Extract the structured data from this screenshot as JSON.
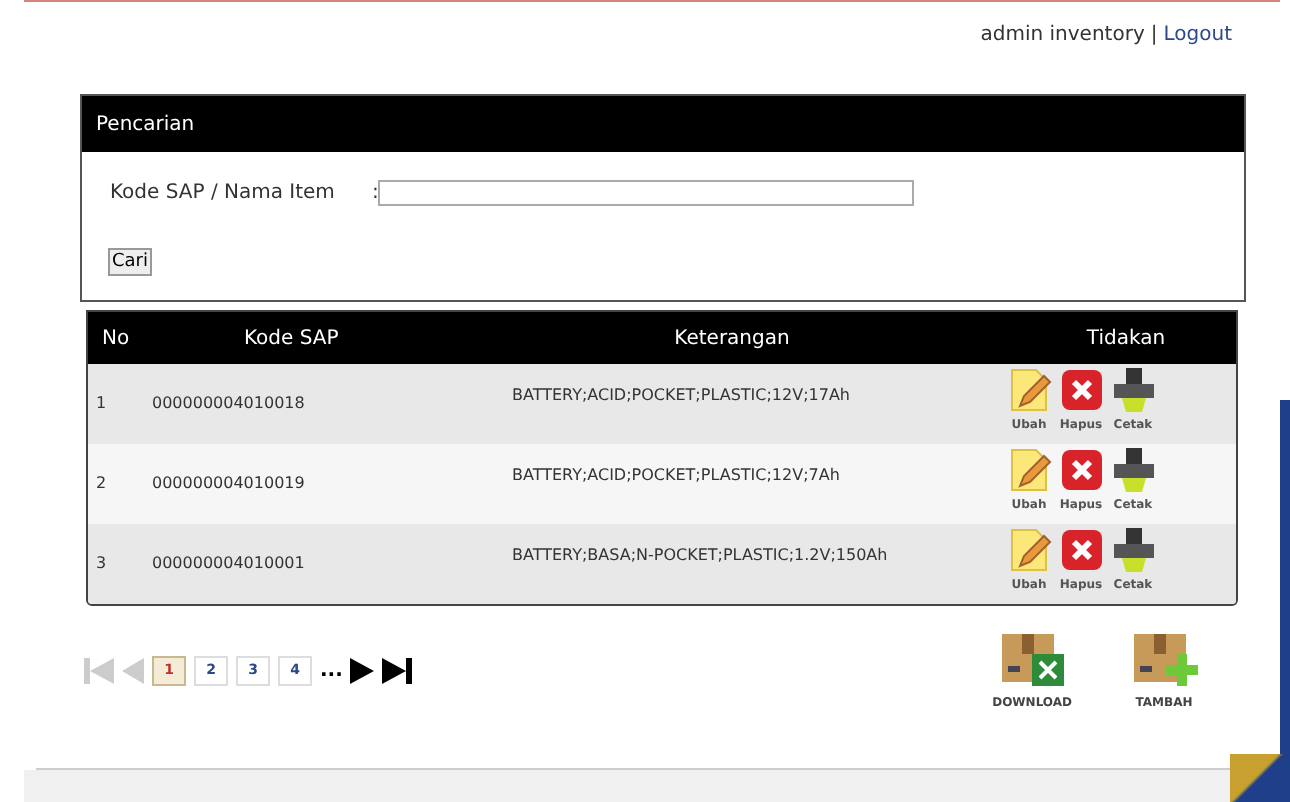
{
  "header": {
    "user": "admin inventory",
    "separator": "|",
    "logout": "Logout"
  },
  "search": {
    "title": "Pencarian",
    "field_label": "Kode SAP / Nama Item",
    "colon": ":",
    "button": "Cari"
  },
  "table": {
    "columns": [
      "No",
      "Kode SAP",
      "Keterangan",
      "Tidakan"
    ],
    "rows": [
      {
        "no": "1",
        "kode": "000000004010018",
        "keterangan": "BATTERY;ACID;POCKET;PLASTIC;12V;17Ah",
        "actions": [
          {
            "kind": "edit",
            "label": "Ubah"
          },
          {
            "kind": "delete",
            "label": "Hapus"
          },
          {
            "kind": "print",
            "label": "Cetak"
          }
        ]
      },
      {
        "no": "2",
        "kode": "000000004010019",
        "keterangan": "BATTERY;ACID;POCKET;PLASTIC;12V;7Ah",
        "actions": [
          {
            "kind": "edit",
            "label": "Ubah"
          },
          {
            "kind": "delete",
            "label": "Hapus"
          },
          {
            "kind": "print",
            "label": "Cetak"
          }
        ]
      },
      {
        "no": "3",
        "kode": "000000004010001",
        "keterangan": "BATTERY;BASA;N-POCKET;PLASTIC;1.2V;150Ah",
        "actions": [
          {
            "kind": "edit",
            "label": "Ubah"
          },
          {
            "kind": "delete",
            "label": "Hapus"
          },
          {
            "kind": "print",
            "label": "Cetak"
          }
        ]
      }
    ]
  },
  "pagination": {
    "first_disabled": true,
    "prev_disabled": true,
    "pages": [
      {
        "label": "1",
        "selected": true
      },
      {
        "label": "2",
        "selected": false
      },
      {
        "label": "3",
        "selected": false
      },
      {
        "label": "4",
        "selected": false
      }
    ],
    "ellipsis": "..."
  },
  "tools": [
    {
      "kind": "download",
      "label": "DOWNLOAD"
    },
    {
      "kind": "add",
      "label": "TAMBAH"
    }
  ]
}
